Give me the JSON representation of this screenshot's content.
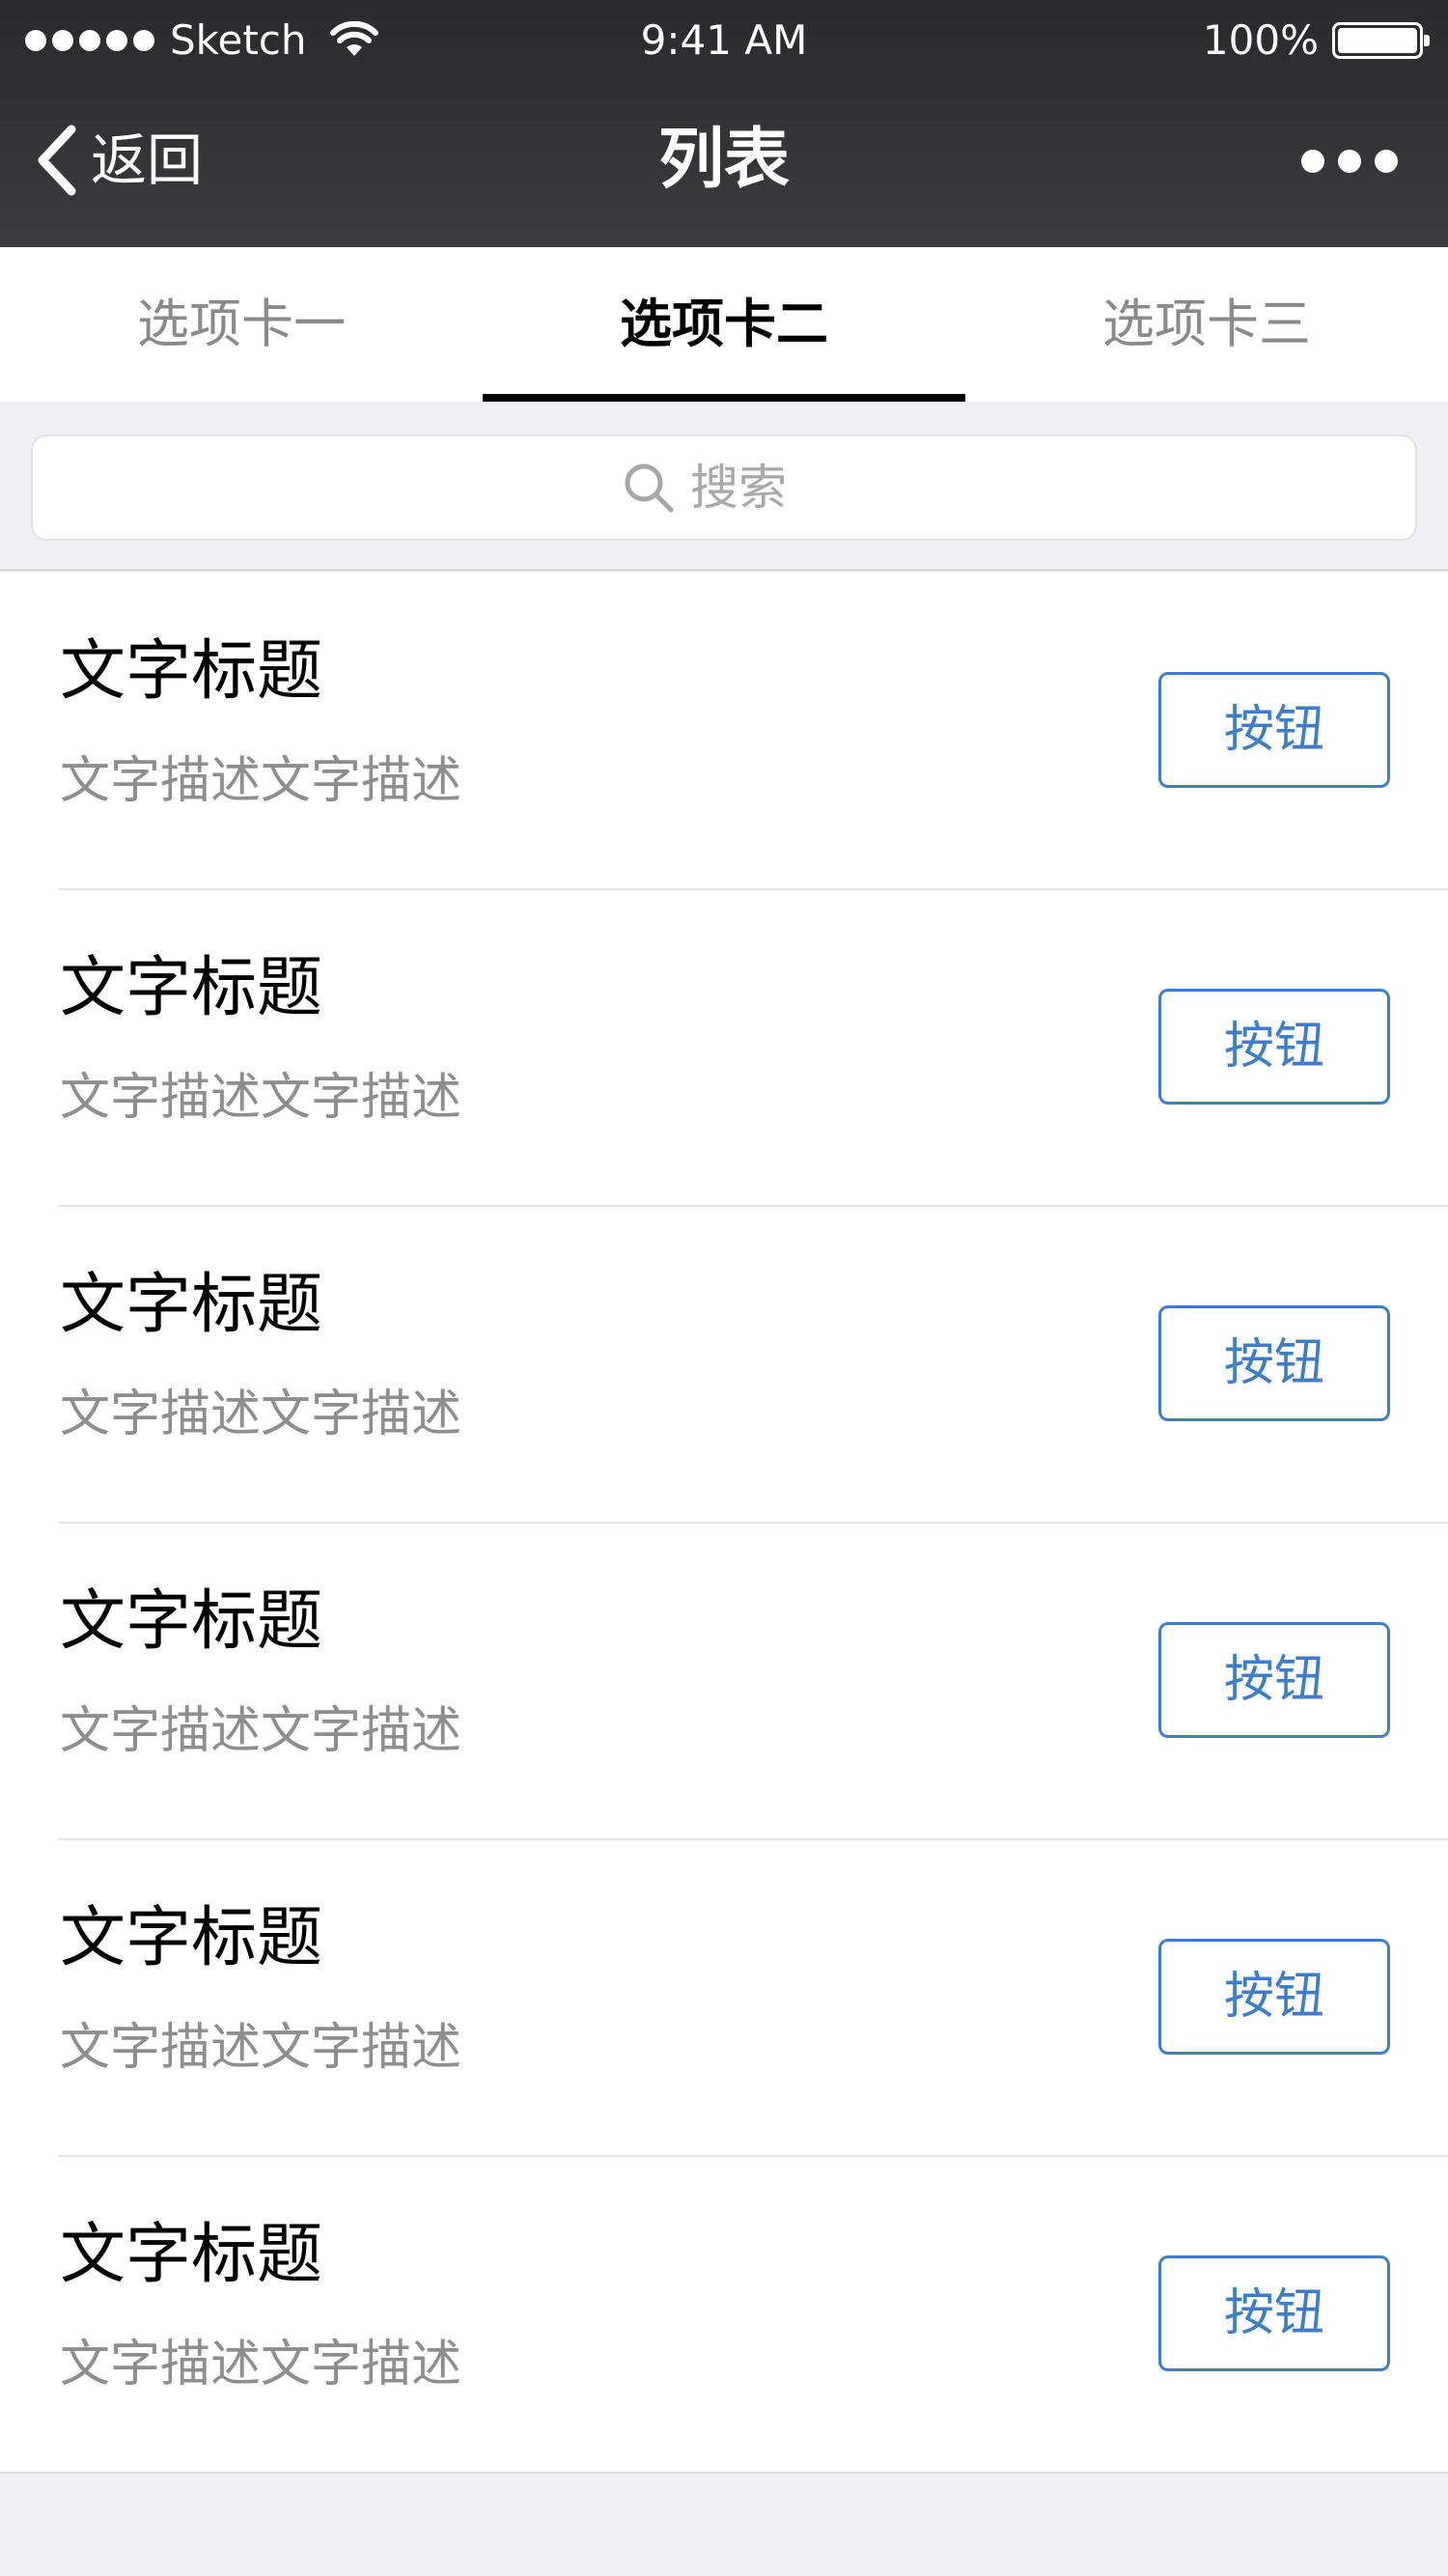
{
  "status_bar": {
    "carrier": "Sketch",
    "time": "9:41 AM",
    "battery": "100%"
  },
  "nav": {
    "back_label": "返回",
    "title": "列表",
    "more_icon": "more-dots-icon"
  },
  "tabs": [
    {
      "label": "选项卡一",
      "active": false
    },
    {
      "label": "选项卡二",
      "active": true
    },
    {
      "label": "选项卡三",
      "active": false
    }
  ],
  "search": {
    "placeholder": "搜索",
    "value": "",
    "icon": "search-icon"
  },
  "list": {
    "items": [
      {
        "title": "文字标题",
        "description": "文字描述文字描述",
        "button": "按钮"
      },
      {
        "title": "文字标题",
        "description": "文字描述文字描述",
        "button": "按钮"
      },
      {
        "title": "文字标题",
        "description": "文字描述文字描述",
        "button": "按钮"
      },
      {
        "title": "文字标题",
        "description": "文字描述文字描述",
        "button": "按钮"
      },
      {
        "title": "文字标题",
        "description": "文字描述文字描述",
        "button": "按钮"
      },
      {
        "title": "文字标题",
        "description": "文字描述文字描述",
        "button": "按钮"
      }
    ]
  },
  "colors": {
    "accent": "#3d7ec9",
    "nav_background": "#333336",
    "page_background": "#efeff4"
  }
}
